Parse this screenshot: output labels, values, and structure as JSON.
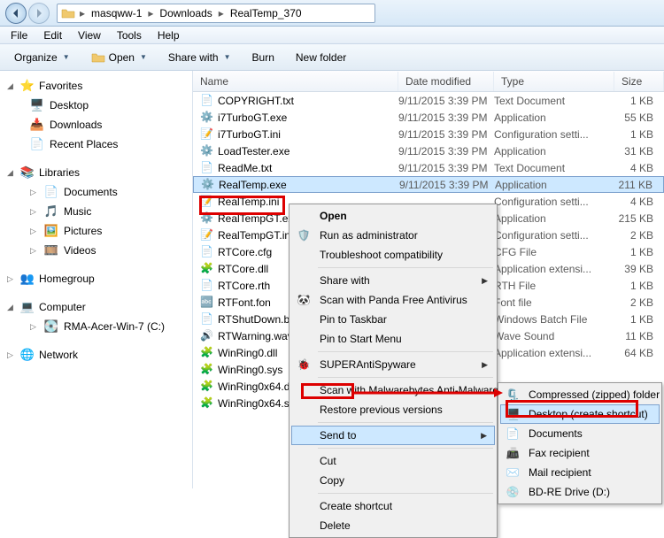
{
  "breadcrumbs": [
    "masqww-1",
    "Downloads",
    "RealTemp_370"
  ],
  "menubar": [
    "File",
    "Edit",
    "View",
    "Tools",
    "Help"
  ],
  "toolbar": {
    "organize": "Organize",
    "open": "Open",
    "share": "Share with",
    "burn": "Burn",
    "newfolder": "New folder"
  },
  "nav": {
    "favorites": {
      "label": "Favorites",
      "items": [
        "Desktop",
        "Downloads",
        "Recent Places"
      ]
    },
    "libraries": {
      "label": "Libraries",
      "items": [
        "Documents",
        "Music",
        "Pictures",
        "Videos"
      ]
    },
    "homegroup": {
      "label": "Homegroup"
    },
    "computer": {
      "label": "Computer",
      "items": [
        "RMA-Acer-Win-7 (C:)"
      ]
    },
    "network": {
      "label": "Network"
    }
  },
  "columns": {
    "name": "Name",
    "date": "Date modified",
    "type": "Type",
    "size": "Size"
  },
  "files": [
    {
      "name": "COPYRIGHT.txt",
      "date": "9/11/2015 3:39 PM",
      "type": "Text Document",
      "size": "1 KB",
      "icon": "txt"
    },
    {
      "name": "i7TurboGT.exe",
      "date": "9/11/2015 3:39 PM",
      "type": "Application",
      "size": "55 KB",
      "icon": "exe"
    },
    {
      "name": "i7TurboGT.ini",
      "date": "9/11/2015 3:39 PM",
      "type": "Configuration setti...",
      "size": "1 KB",
      "icon": "ini"
    },
    {
      "name": "LoadTester.exe",
      "date": "9/11/2015 3:39 PM",
      "type": "Application",
      "size": "31 KB",
      "icon": "exe"
    },
    {
      "name": "ReadMe.txt",
      "date": "9/11/2015 3:39 PM",
      "type": "Text Document",
      "size": "4 KB",
      "icon": "txt"
    },
    {
      "name": "RealTemp.exe",
      "date": "9/11/2015 3:39 PM",
      "type": "Application",
      "size": "211 KB",
      "icon": "exe",
      "selected": true
    },
    {
      "name": "RealTemp.ini",
      "date": "",
      "type": "Configuration setti...",
      "size": "4 KB",
      "icon": "ini"
    },
    {
      "name": "RealTempGT.exe",
      "date": "",
      "type": "Application",
      "size": "215 KB",
      "icon": "exe"
    },
    {
      "name": "RealTempGT.ini",
      "date": "",
      "type": "Configuration setti...",
      "size": "2 KB",
      "icon": "ini"
    },
    {
      "name": "RTCore.cfg",
      "date": "",
      "type": "CFG File",
      "size": "1 KB",
      "icon": "cfg"
    },
    {
      "name": "RTCore.dll",
      "date": "",
      "type": "Application extensi...",
      "size": "39 KB",
      "icon": "dll"
    },
    {
      "name": "RTCore.rth",
      "date": "",
      "type": "RTH File",
      "size": "1 KB",
      "icon": "file"
    },
    {
      "name": "RTFont.fon",
      "date": "",
      "type": "Font file",
      "size": "2 KB",
      "icon": "font"
    },
    {
      "name": "RTShutDown.bat",
      "date": "",
      "type": "Windows Batch File",
      "size": "1 KB",
      "icon": "bat"
    },
    {
      "name": "RTWarning.wav",
      "date": "",
      "type": "Wave Sound",
      "size": "11 KB",
      "icon": "wav"
    },
    {
      "name": "WinRing0.dll",
      "date": "",
      "type": "Application extensi...",
      "size": "64 KB",
      "icon": "dll"
    },
    {
      "name": "WinRing0.sys",
      "date": "",
      "type": "",
      "size": "",
      "icon": "sys"
    },
    {
      "name": "WinRing0x64.dll",
      "date": "",
      "type": "",
      "size": "",
      "icon": "dll"
    },
    {
      "name": "WinRing0x64.sys",
      "date": "",
      "type": "",
      "size": "",
      "icon": "sys"
    }
  ],
  "ctx": {
    "open": "Open",
    "runas": "Run as administrator",
    "trouble": "Troubleshoot compatibility",
    "sharewith": "Share with",
    "panda": "Scan with Panda Free Antivirus",
    "pintaskbar": "Pin to Taskbar",
    "pinstart": "Pin to Start Menu",
    "sas": "SUPERAntiSpyware",
    "mbam": "Scan with Malwarebytes Anti-Malware",
    "restore": "Restore previous versions",
    "sendto": "Send to",
    "cut": "Cut",
    "copy": "Copy",
    "shortcut": "Create shortcut",
    "delete": "Delete"
  },
  "sendto": {
    "zip": "Compressed (zipped) folder",
    "desktop": "Desktop (create shortcut)",
    "docs": "Documents",
    "fax": "Fax recipient",
    "mail": "Mail recipient",
    "bdre": "BD-RE Drive (D:)"
  }
}
